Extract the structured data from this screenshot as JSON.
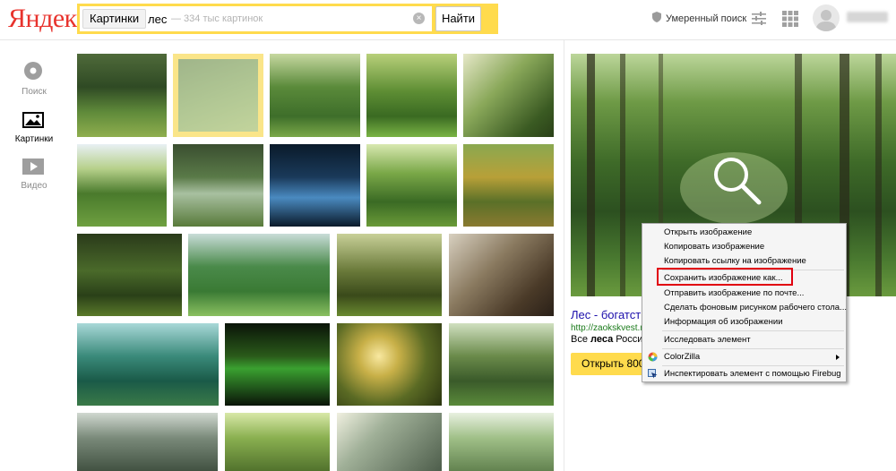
{
  "header": {
    "logo": "Яндекс",
    "search_scope": "Картинки",
    "search_query": "лес",
    "search_hint": "— 334 тыс картинок",
    "find_label": "Найти",
    "safe_search_label": "Умеренный поиск",
    "username": "vadesign"
  },
  "nav": {
    "items": [
      {
        "label": "Поиск",
        "icon": "search-circle-icon"
      },
      {
        "label": "Картинки",
        "icon": "image-icon"
      },
      {
        "label": "Видео",
        "icon": "play-icon"
      }
    ]
  },
  "result": {
    "title": "Лес - богатство",
    "url": "http://zaokskvest.r",
    "desc_prefix": "Все ",
    "desc_bold": "леса",
    "desc_suffix": " России",
    "open_label": "Открыть 800×"
  },
  "context_menu": {
    "items": [
      {
        "label": "Открыть изображение"
      },
      {
        "label": "Копировать изображение"
      },
      {
        "label": "Копировать ссылку на изображение"
      },
      {
        "label": "Сохранить изображение как..."
      },
      {
        "label": "Отправить изображение по почте..."
      },
      {
        "label": "Сделать фоновым рисунком рабочего стола..."
      },
      {
        "label": "Информация об изображении"
      },
      {
        "label": "Исследовать элемент"
      },
      {
        "label": "ColorZilla"
      },
      {
        "label": "Инспектировать элемент с помощью Firebug"
      }
    ]
  },
  "colors": {
    "brand_red": "#e8332d",
    "search_yellow": "#ffdb4d",
    "selection_outline": "#f7d74a",
    "highlight_red": "#e1000f",
    "link_blue": "#1a0dab",
    "url_green": "#1a7a1a"
  }
}
